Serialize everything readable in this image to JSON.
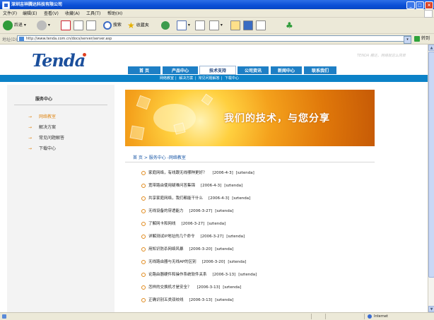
{
  "window": {
    "title": "深圳吉祥腾达科技有限公司"
  },
  "menu": [
    "文件(F)",
    "编辑(E)",
    "查看(V)",
    "收藏(A)",
    "工具(T)",
    "帮助(H)"
  ],
  "toolbar": {
    "back": "后退",
    "search": "搜索",
    "favorites": "收藏夹"
  },
  "address": {
    "label": "地址(D)",
    "url": "http://www.tenda.com.cn/docs/server/server.asp",
    "go": "转到"
  },
  "site": {
    "logo": "Tenda",
    "slogan": "TENDA 腾达，网络就这么简单",
    "nav": [
      "首 页",
      "产品中心",
      "技术支持",
      "公司资讯",
      "新闻中心",
      "联系我们"
    ],
    "subnav": [
      "网络教室",
      "解决方案",
      "常见问题解答",
      "下载中心"
    ]
  },
  "sidebar": {
    "title": "服务中心",
    "items": [
      "网络教室",
      "解决方案",
      "常见问题解答",
      "下载中心"
    ]
  },
  "banner": {
    "text": "我们的技术，与您分享"
  },
  "breadcrumb": "首 页 > 服务中心 -网络教室",
  "articles": [
    {
      "title": "家庭网络，有线跟无线哪种更好？",
      "date": "[2006-4-3]",
      "author": "[sztenda]"
    },
    {
      "title": "宽带路由使用疑难问答集锦",
      "date": "[2006-4-3]",
      "author": "[sztenda]"
    },
    {
      "title": "共享家庭网络，我们都能干什么",
      "date": "[2006-4-3]",
      "author": "[sztenda]"
    },
    {
      "title": "无线设备的穿透能力",
      "date": "[2006-3-27]",
      "author": "[sztenda]"
    },
    {
      "title": "了解网卡和网线",
      "date": "[2006-3-27]",
      "author": "[sztenda]"
    },
    {
      "title": "详解测试IP地址的几个命令",
      "date": "[2006-3-27]",
      "author": "[sztenda]"
    },
    {
      "title": "用知识防杀网络风暴",
      "date": "[2006-3-20]",
      "author": "[sztenda]"
    },
    {
      "title": "无线路由器与无线AP的区别",
      "date": "[2006-3-20]",
      "author": "[sztenda]"
    },
    {
      "title": "论路由器硬件和操作系统软件关系",
      "date": "[2006-3-13]",
      "author": "[sztenda]"
    },
    {
      "title": "怎样的交换机才是安全？",
      "date": "[2006-3-13]",
      "author": "[sztenda]"
    },
    {
      "title": "正确识别五类双绞线",
      "date": "[2006-3-13]",
      "author": "[sztenda]"
    }
  ],
  "status": {
    "zone": "Internet"
  },
  "colors": {
    "nav_blue": "#1e7fc5",
    "accent_orange": "#e08a1c",
    "logo_blue": "#1b4f9c"
  }
}
